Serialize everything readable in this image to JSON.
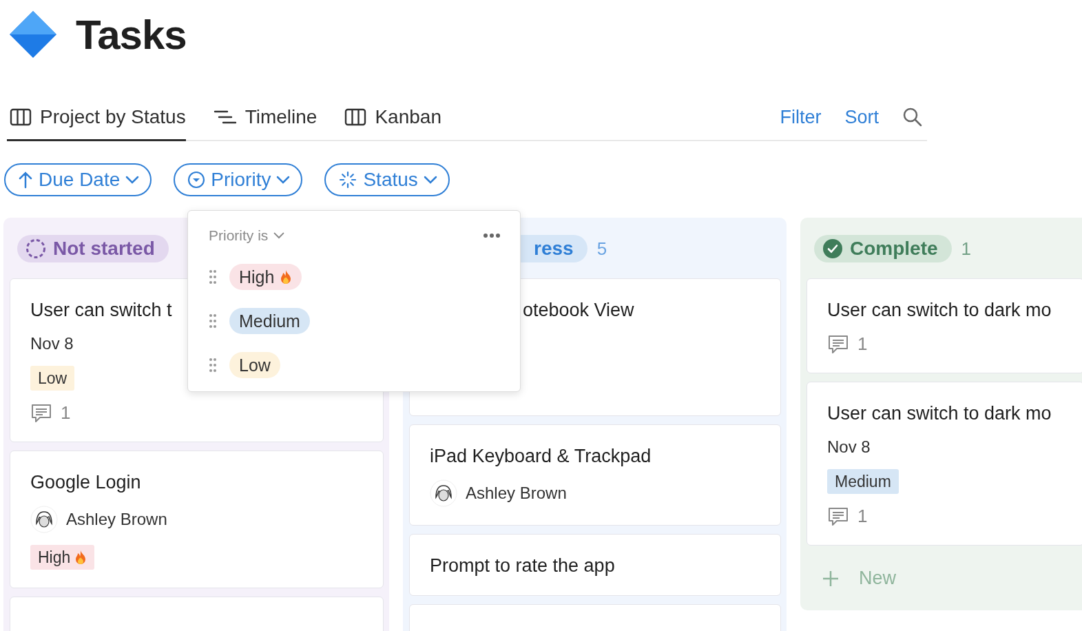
{
  "page": {
    "title": "Tasks"
  },
  "views": [
    {
      "label": "Project by Status",
      "kind": "board",
      "selected": true
    },
    {
      "label": "Timeline",
      "kind": "timeline",
      "selected": false
    },
    {
      "label": "Kanban",
      "kind": "board",
      "selected": false
    }
  ],
  "actions": [
    {
      "label": "Filter"
    },
    {
      "label": "Sort"
    }
  ],
  "chips": [
    {
      "label": "Due Date",
      "kind": "sort"
    },
    {
      "label": "Priority",
      "kind": "priority"
    },
    {
      "label": "Status",
      "kind": "status"
    }
  ],
  "columns": [
    {
      "status": "Not started",
      "kind": "not_started",
      "cards": [
        {
          "kind": "full",
          "title": "User can switch t",
          "date": "Nov 8",
          "tag": {
            "label": "Low",
            "kind": "low"
          },
          "comments": "1"
        },
        {
          "kind": "full",
          "title": "Google Login",
          "assignee": "Ashley Brown",
          "tag": {
            "label": "High",
            "kind": "high"
          }
        },
        {
          "kind": "cut"
        }
      ]
    },
    {
      "status": "ress",
      "kind": "in_progress",
      "count": "5",
      "cards": [
        {
          "kind": "covered",
          "title": "otebook View"
        },
        {
          "kind": "full",
          "title": "iPad Keyboard & Trackpad",
          "assignee": "Ashley Brown"
        },
        {
          "kind": "full",
          "title": "Prompt to rate the app"
        },
        {
          "kind": "cut"
        }
      ]
    },
    {
      "status": "Complete",
      "kind": "complete",
      "count": "1",
      "new_label": "New",
      "cards": [
        {
          "kind": "full",
          "title": "User can switch to dark mo",
          "comments": "1"
        },
        {
          "kind": "full",
          "title": "User can switch to dark mo",
          "date": "Nov 8",
          "tag": {
            "label": "Medium",
            "kind": "medium"
          },
          "comments": "1"
        }
      ]
    }
  ],
  "popover": {
    "heading": "Priority is",
    "options": [
      {
        "label": "High",
        "kind": "high"
      },
      {
        "label": "Medium",
        "kind": "medium"
      },
      {
        "label": "Low",
        "kind": "low"
      }
    ]
  }
}
